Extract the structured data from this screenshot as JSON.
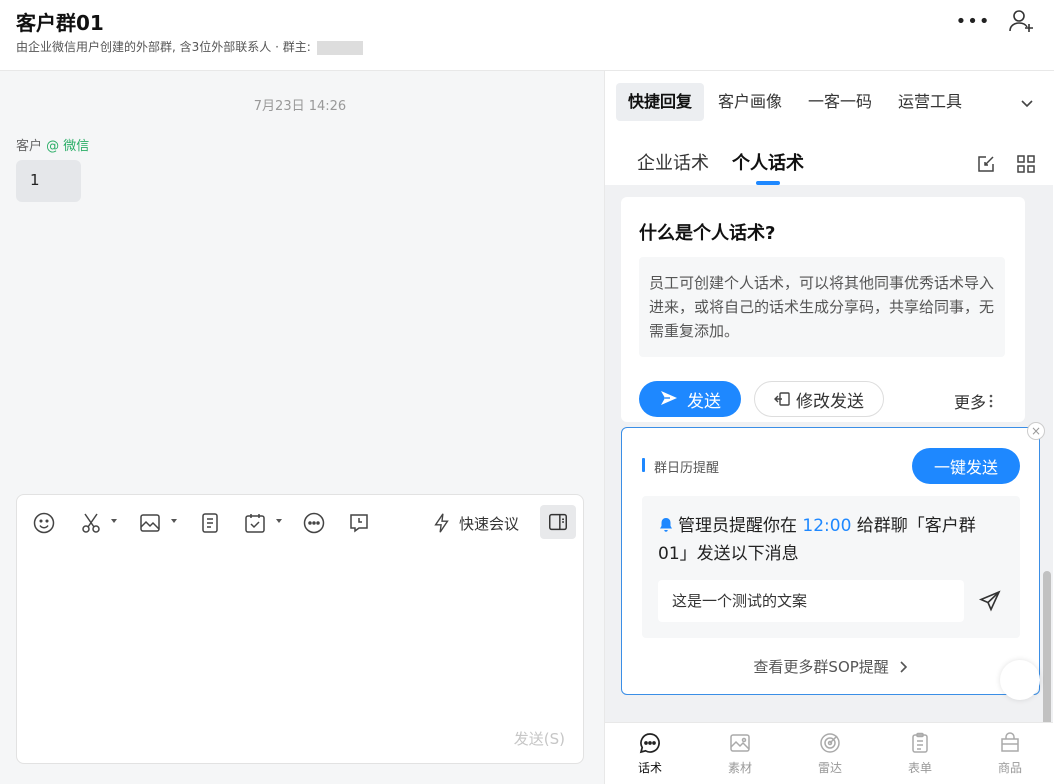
{
  "header": {
    "title": "客户群01",
    "subtitle": "由企业微信用户创建的外部群, 含3位外部联系人 · 群主: ",
    "more_label": "•••"
  },
  "chat": {
    "timestamp": "7月23日 14:26",
    "sender_name": "客户",
    "sender_source": "@ 微信",
    "message": "1"
  },
  "composer": {
    "quick_meeting_label": "快速会议",
    "send_hint": "发送(S)"
  },
  "right_panel": {
    "top_tabs": [
      {
        "label": "快捷回复",
        "active": true
      },
      {
        "label": "客户画像",
        "active": false
      },
      {
        "label": "一客一码",
        "active": false
      },
      {
        "label": "运营工具",
        "active": false
      }
    ],
    "sub_tabs": [
      {
        "label": "企业话术",
        "active": false
      },
      {
        "label": "个人话术",
        "active": true
      }
    ],
    "card": {
      "title": "什么是个人话术?",
      "body": "员工可创建个人话术，可以将其他同事优秀话术导入进来，或将自己的话术生成分享码，共享给同事，无需重复添加。",
      "send_label": "发送",
      "edit_send_label": "修改发送",
      "more_label": "更多"
    },
    "reminder": {
      "title": "群日历提醒",
      "one_key_send": "一键发送",
      "msg_prefix": "管理员提醒你在 ",
      "msg_time": "12:00",
      "msg_suffix": " 给群聊「客户群01」发送以下消息",
      "copy_text": "这是一个测试的文案",
      "more_link": "查看更多群SOP提醒"
    },
    "bottom_nav": [
      {
        "label": "话术",
        "active": true
      },
      {
        "label": "素材",
        "active": false
      },
      {
        "label": "雷达",
        "active": false
      },
      {
        "label": "表单",
        "active": false
      },
      {
        "label": "商品",
        "active": false
      }
    ]
  },
  "colors": {
    "accent": "#1e88ff",
    "wechat_green": "#2bae67"
  }
}
